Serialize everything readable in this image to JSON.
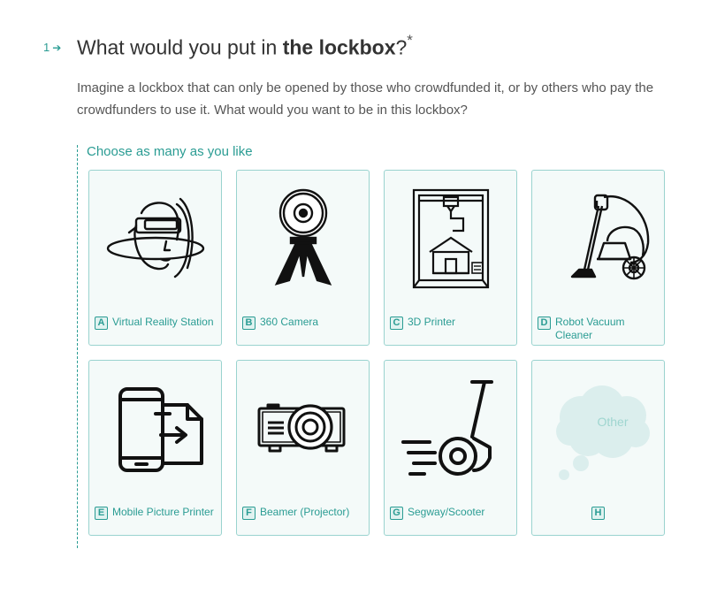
{
  "question": {
    "number": "1",
    "arrow": "➔",
    "title_start": "What would you put in ",
    "title_bold": "the lockbox",
    "title_end": "?",
    "required_mark": "*",
    "description": "Imagine a lockbox that can only be opened by those who crowdfunded it, or by others who pay the crowdfunders to use it. What would you want to be in this lockbox?",
    "hint": "Choose as many as you like"
  },
  "choices": [
    {
      "key": "A",
      "label": "Virtual Reality Station",
      "icon": "vr-headset-icon"
    },
    {
      "key": "B",
      "label": "360 Camera",
      "icon": "360-camera-icon"
    },
    {
      "key": "C",
      "label": "3D Printer",
      "icon": "3d-printer-icon"
    },
    {
      "key": "D",
      "label": "Robot Vacuum Cleaner",
      "icon": "vacuum-cleaner-icon"
    },
    {
      "key": "E",
      "label": "Mobile Picture Printer",
      "icon": "mobile-printer-icon"
    },
    {
      "key": "F",
      "label": "Beamer (Projector)",
      "icon": "projector-icon"
    },
    {
      "key": "G",
      "label": "Segway/Scooter",
      "icon": "segway-icon"
    },
    {
      "key": "H",
      "label": "",
      "icon": "thought-bubble-icon",
      "bubble_text": "Other"
    }
  ],
  "colors": {
    "accent": "#2a9c93",
    "card_border": "#9ad3cf",
    "card_bg": "#f4faf9"
  }
}
